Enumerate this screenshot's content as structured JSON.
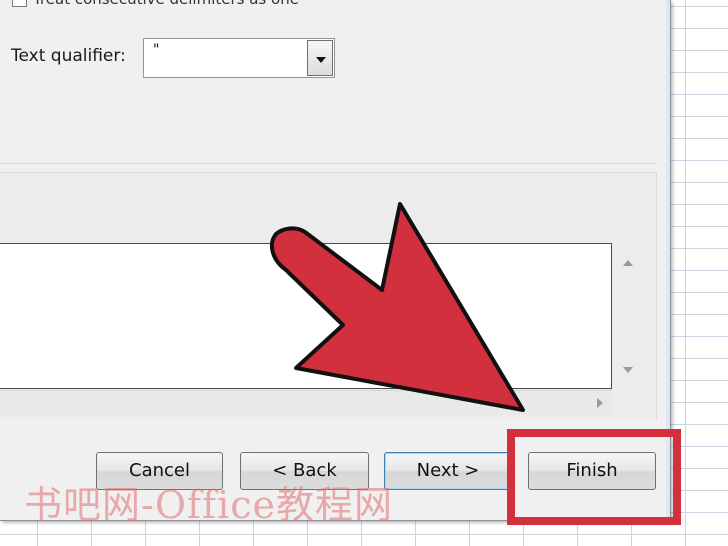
{
  "dialog": {
    "top_checkbox_label": "Treat consecutive delimiters as one",
    "text_qualifier_label": "Text qualifier:",
    "text_qualifier_value": "\""
  },
  "buttons": {
    "cancel": "Cancel",
    "back": "< Back",
    "next": "Next >",
    "finish": "Finish"
  },
  "annotation": {
    "arrow_color": "#d3303e",
    "highlight_color": "#d3303e"
  },
  "watermark": "书吧网-Office教程网"
}
